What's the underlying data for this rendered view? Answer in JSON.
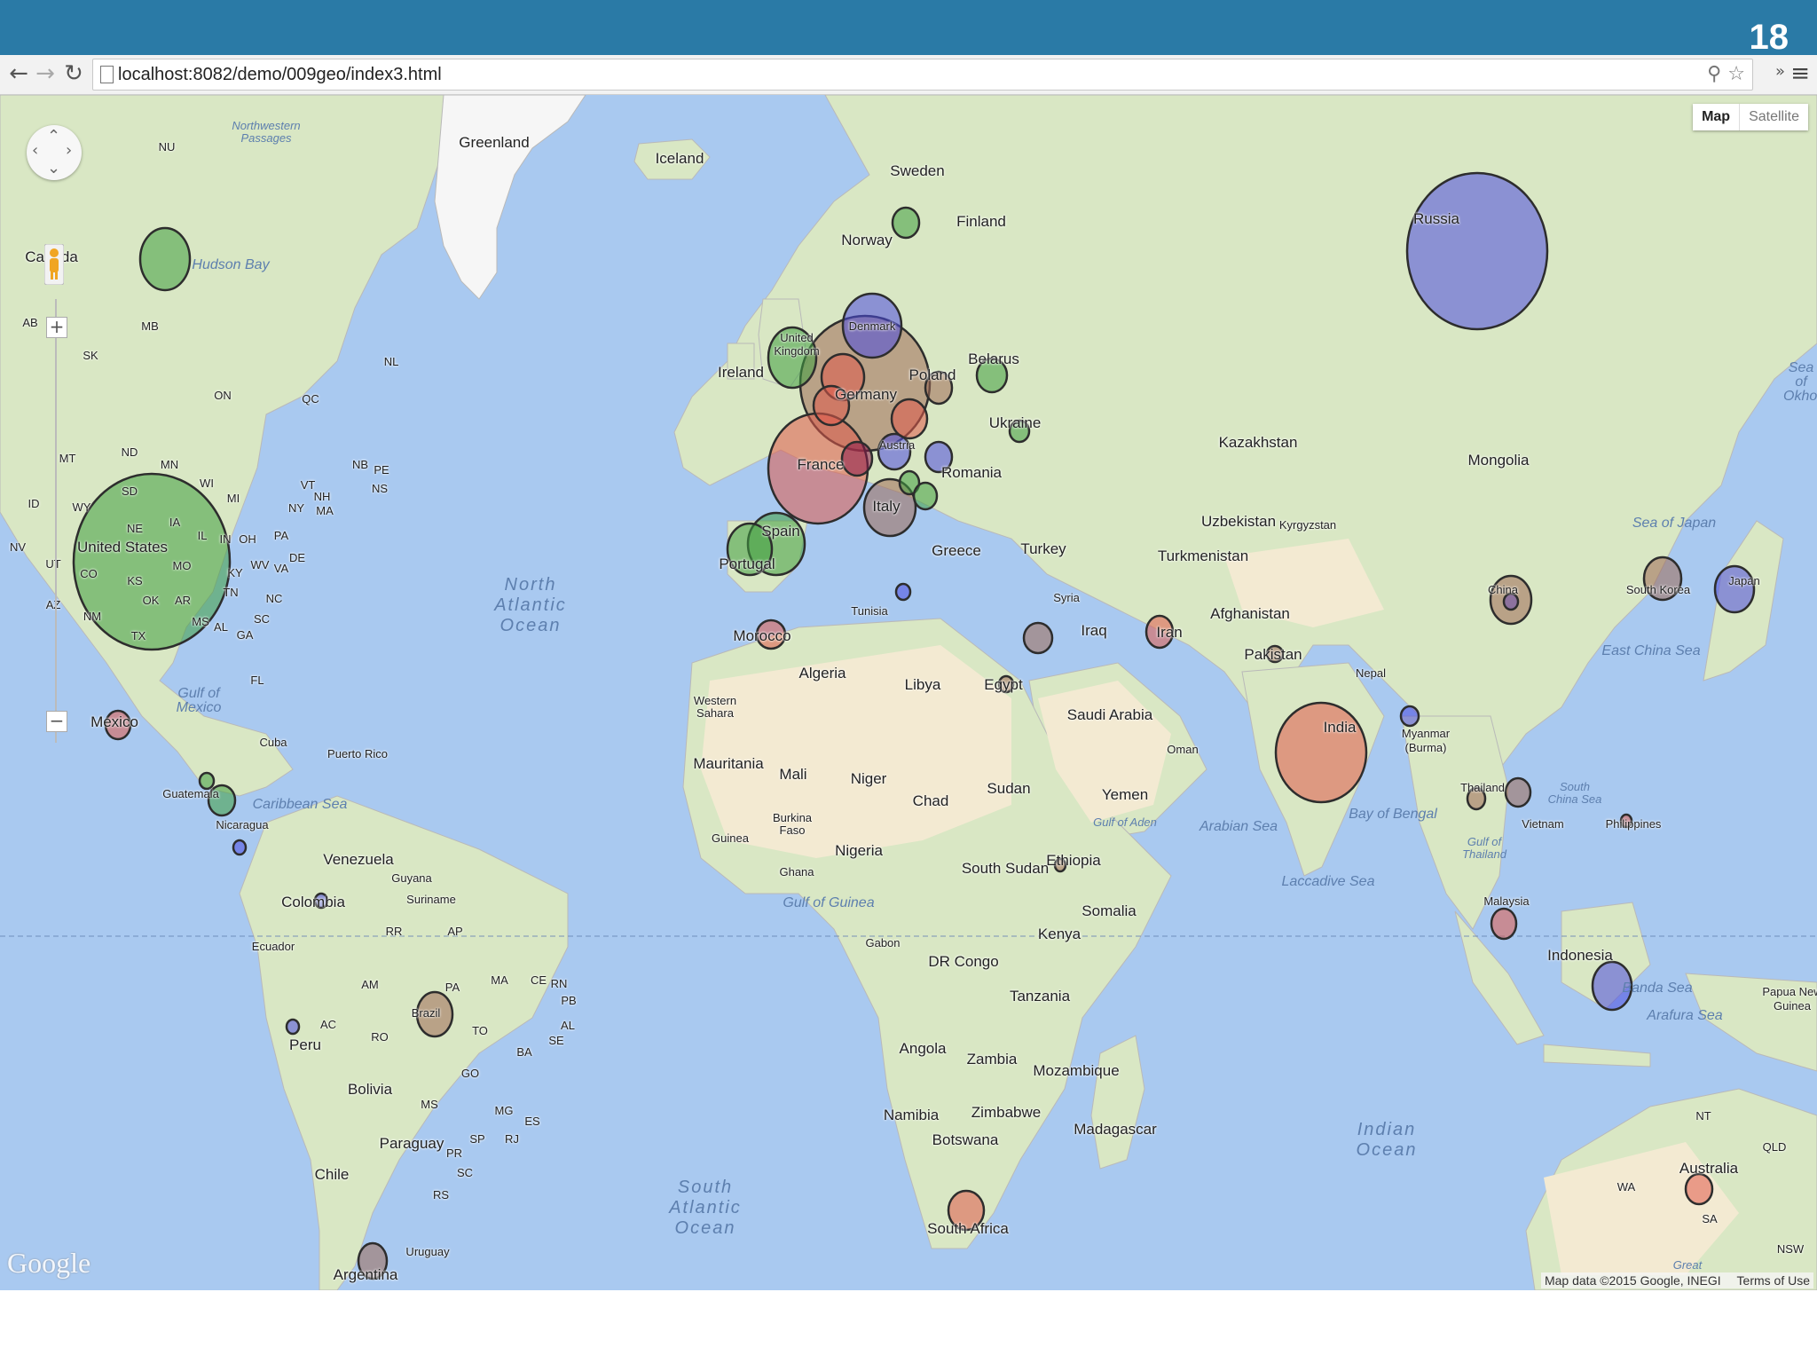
{
  "slide": {
    "number": "18"
  },
  "browser": {
    "url": "localhost:8082/demo/009geo/index3.html",
    "back_icon": "back-arrow-icon",
    "forward_icon": "forward-arrow-icon",
    "reload_icon": "reload-icon"
  },
  "map": {
    "type_control": {
      "map_label": "Map",
      "satellite_label": "Satellite"
    },
    "google_logo": "Google",
    "attribution": "Map data ©2015 Google, INEGI",
    "terms": "Terms of Use",
    "colors": {
      "water": "#a9c9f0",
      "land": "#d9e7c4",
      "desert": "#f3ead2",
      "green_circle": "#3f9f3f",
      "red_circle": "#e05a4a",
      "blue_circle": "#4a4ae0",
      "brown_circle": "#9e6a55"
    },
    "country_labels": [
      "Greenland",
      "Iceland",
      "Sweden",
      "Finland",
      "Norway",
      "Canada",
      "Denmark",
      "United Kingdom",
      "Ireland",
      "Belarus",
      "Poland",
      "Germany",
      "Ukraine",
      "France",
      "Austria",
      "Romania",
      "Italy",
      "Spain",
      "Portugal",
      "Greece",
      "Turkey",
      "Kazakhstan",
      "Mongolia",
      "Russia",
      "Uzbekistan",
      "Kyrgyzstan",
      "Turkmenistan",
      "Syria",
      "Iraq",
      "Iran",
      "Afghanistan",
      "Pakistan",
      "Tunisia",
      "Morocco",
      "Algeria",
      "Libya",
      "Egypt",
      "Saudi Arabia",
      "Oman",
      "Western Sahara",
      "Mauritania",
      "Mali",
      "Niger",
      "Chad",
      "Sudan",
      "Yemen",
      "Nepal",
      "India",
      "Myanmar (Burma)",
      "Thailand",
      "Vietnam",
      "Philippines",
      "South Korea",
      "Japan",
      "China",
      "United States",
      "Mexico",
      "Cuba",
      "Puerto Rico",
      "Guatemala",
      "Nicaragua",
      "Venezuela",
      "Guyana",
      "Suriname",
      "Colombia",
      "Ecuador",
      "Peru",
      "Brazil",
      "Bolivia",
      "Paraguay",
      "Chile",
      "Uruguay",
      "Argentina",
      "Burkina Faso",
      "Guinea",
      "Ghana",
      "Nigeria",
      "South Sudan",
      "Ethiopia",
      "Somalia",
      "Kenya",
      "Gabon",
      "DR Congo",
      "Tanzania",
      "Angola",
      "Zambia",
      "Mozambique",
      "Namibia",
      "Zimbabwe",
      "Botswana",
      "Madagascar",
      "South Africa",
      "Malaysia",
      "Indonesia",
      "Papua New Guinea",
      "Australia"
    ],
    "region_labels": [
      "Northwestern Passages",
      "NU",
      "MB",
      "SK",
      "AB",
      "ON",
      "QC",
      "NL",
      "NB",
      "PE",
      "NS",
      "ND",
      "MT",
      "SD",
      "MN",
      "WI",
      "MI",
      "NY",
      "VT",
      "NH",
      "MA",
      "ID",
      "WY",
      "NE",
      "IA",
      "IL",
      "IN",
      "OH",
      "PA",
      "NV",
      "UT",
      "CO",
      "KS",
      "MO",
      "KY",
      "WV",
      "VA",
      "DE",
      "AZ",
      "NM",
      "OK",
      "AR",
      "TN",
      "NC",
      "TX",
      "MS",
      "AL",
      "GA",
      "SC",
      "FL",
      "AM",
      "PA",
      "MA",
      "CE",
      "RN",
      "PB",
      "AC",
      "RO",
      "TO",
      "BA",
      "SE",
      "AL",
      "GO",
      "MS",
      "MG",
      "ES",
      "SP",
      "RJ",
      "PR",
      "SC",
      "RS",
      "RR",
      "AP",
      "NT",
      "QLD",
      "WA",
      "SA",
      "NSW"
    ],
    "water_labels": [
      "Hudson Bay",
      "Gulf of Mexico",
      "Caribbean Sea",
      "North Atlantic Ocean",
      "South Atlantic Ocean",
      "Gulf of Guinea",
      "Gulf of Aden",
      "Arabian Sea",
      "Laccadive Sea",
      "Bay of Bengal",
      "Gulf of Thailand",
      "South China Sea",
      "East China Sea",
      "Sea of Japan",
      "Sea of Okhotsk",
      "Banda Sea",
      "Arafura Sea",
      "Indian Ocean",
      "Great"
    ],
    "data_circles": [
      {
        "label": "Russia",
        "color": "blue",
        "size": "very large"
      },
      {
        "label": "United States",
        "color": "green",
        "size": "very large"
      },
      {
        "label": "Germany",
        "color": "brown",
        "size": "large"
      },
      {
        "label": "France",
        "color": "red",
        "size": "large"
      },
      {
        "label": "India",
        "color": "red",
        "size": "large"
      },
      {
        "label": "Denmark",
        "color": "blue",
        "size": "medium"
      },
      {
        "label": "United Kingdom",
        "color": "green",
        "size": "medium"
      },
      {
        "label": "Spain",
        "color": "green",
        "size": "medium"
      },
      {
        "label": "Portugal",
        "color": "green",
        "size": "medium"
      },
      {
        "label": "Italy",
        "color": "brown",
        "size": "medium"
      },
      {
        "label": "Canada",
        "color": "green",
        "size": "medium"
      },
      {
        "label": "China",
        "color": "brown",
        "size": "medium"
      },
      {
        "label": "Japan",
        "color": "blue",
        "size": "medium"
      },
      {
        "label": "South Korea",
        "color": "brown",
        "size": "medium"
      },
      {
        "label": "Indonesia",
        "color": "blue",
        "size": "medium"
      },
      {
        "label": "South Africa",
        "color": "red",
        "size": "medium"
      },
      {
        "label": "Brazil",
        "color": "brown",
        "size": "medium"
      },
      {
        "label": "Iran",
        "color": "red",
        "size": "small"
      },
      {
        "label": "Morocco",
        "color": "red",
        "size": "small"
      },
      {
        "label": "Mexico",
        "color": "red",
        "size": "small"
      },
      {
        "label": "Australia",
        "color": "red",
        "size": "small"
      },
      {
        "label": "Malaysia",
        "color": "red",
        "size": "small"
      },
      {
        "label": "Argentina",
        "color": "brown",
        "size": "small"
      },
      {
        "label": "Belarus",
        "color": "green",
        "size": "small"
      },
      {
        "label": "Sweden",
        "color": "green",
        "size": "small"
      },
      {
        "label": "Poland",
        "color": "brown",
        "size": "small"
      },
      {
        "label": "Austria",
        "color": "blue",
        "size": "small"
      },
      {
        "label": "Romania",
        "color": "blue",
        "size": "small"
      },
      {
        "label": "Ukraine",
        "color": "green",
        "size": "small"
      },
      {
        "label": "Thailand",
        "color": "brown",
        "size": "small"
      },
      {
        "label": "Vietnam",
        "color": "brown",
        "size": "small"
      },
      {
        "label": "Syria",
        "color": "brown",
        "size": "small"
      }
    ]
  }
}
